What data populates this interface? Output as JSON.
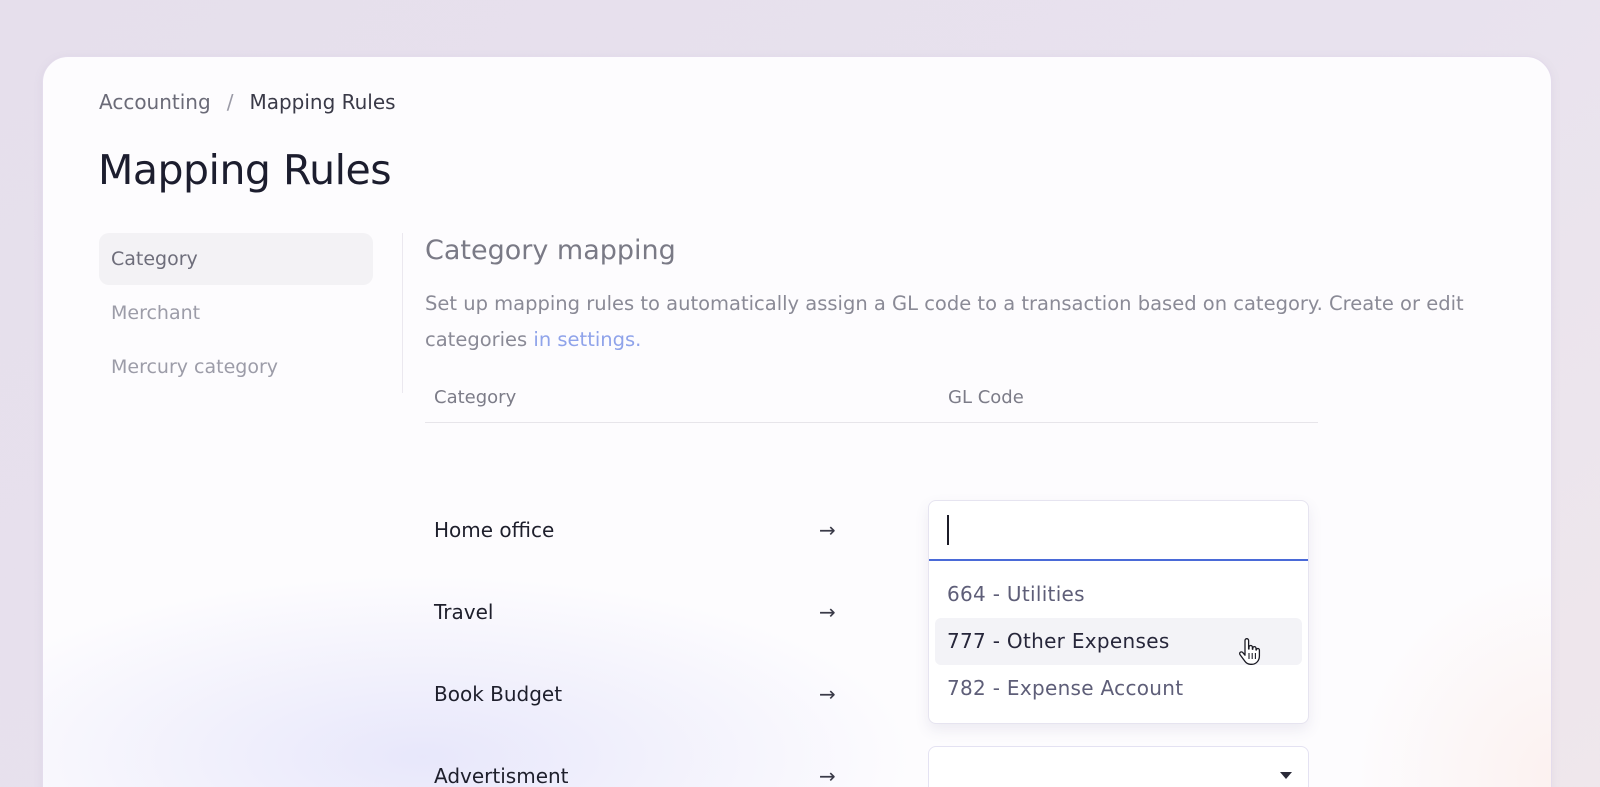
{
  "breadcrumb": {
    "parent": "Accounting",
    "separator": "/",
    "current": "Mapping Rules"
  },
  "page": {
    "title": "Mapping Rules"
  },
  "sidebar": {
    "items": [
      {
        "label": "Category",
        "active": true
      },
      {
        "label": "Merchant",
        "active": false
      },
      {
        "label": "Mercury category",
        "active": false
      }
    ]
  },
  "section": {
    "title": "Category mapping",
    "description": "Set up mapping rules to automatically assign a GL code to a transaction based on category. Create or edit categories ",
    "link_text": "in settings."
  },
  "table": {
    "headers": {
      "category": "Category",
      "gl_code": "GL Code"
    },
    "arrow": "→",
    "rows": [
      {
        "category": "Home office",
        "gl_code": ""
      },
      {
        "category": "Travel",
        "gl_code": ""
      },
      {
        "category": "Book Budget",
        "gl_code": ""
      },
      {
        "category": "Advertisment",
        "gl_code": ""
      }
    ]
  },
  "combobox": {
    "input_value": "",
    "options": [
      {
        "label": "664 - Utilities"
      },
      {
        "label": "777 - Other Expenses",
        "hovered": true
      },
      {
        "label": "782 - Expense Account"
      }
    ]
  },
  "colors": {
    "accent": "#4a6ad8",
    "link": "#8fa3ea",
    "title": "#1c1d2e"
  },
  "icons": {
    "arrow": "arrow-right-icon",
    "caret": "caret-down-icon",
    "cursor": "pointer-hand-icon"
  }
}
